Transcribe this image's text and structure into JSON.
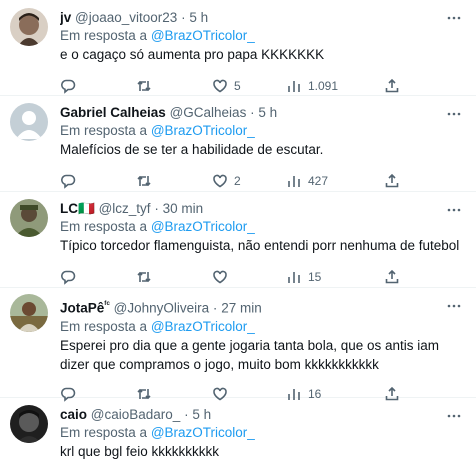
{
  "tweets": [
    {
      "name": "jv",
      "handle": "@joaao_vitoor23",
      "time": "5 h",
      "reply_prefix": "Em resposta a",
      "reply_to": "@BrazOTricolor_",
      "text": "e o cagaço só aumenta pro papa KKKKKKK",
      "likes": "5",
      "views": "1.091",
      "avatar_color": "#8a6d5a"
    },
    {
      "name": "Gabriel Calheias",
      "handle": "@GCalheias",
      "time": "5 h",
      "reply_prefix": "Em resposta a",
      "reply_to": "@BrazOTricolor_",
      "text": "Malefícios de se ter a habilidade de escutar.",
      "likes": "2",
      "views": "427",
      "avatar_color": "#c4cfd6"
    },
    {
      "name": "LC",
      "flag": "🇮🇹",
      "handle": "@lcz_tyf",
      "time": "30 min",
      "reply_prefix": "Em resposta a",
      "reply_to": "@BrazOTricolor_",
      "text": "Típico torcedor flamenguista, não entendi porr nenhuma de futebol",
      "likes": "",
      "views": "15",
      "avatar_color": "#5a6a3e"
    },
    {
      "name": "JotaPê",
      "name_sup": "ᶠᶜ",
      "handle": "@JohnyOliveira",
      "time": "27 min",
      "reply_prefix": "Em resposta a",
      "reply_to": "@BrazOTricolor_",
      "text": "Esperei pro dia que a gente jogaria tanta bola, que os antis iam dizer que compramos o jogo, muito bom kkkkkkkkkkk",
      "likes": "",
      "views": "16",
      "avatar_color": "#7d6a48"
    },
    {
      "name": "caio",
      "handle": "@caioBadaro_",
      "time": "5 h",
      "reply_prefix": "Em resposta a",
      "reply_to": "@BrazOTricolor_",
      "text": "krl que bgl feio kkkkkkkkkk",
      "avatar_color": "#3a3a3a"
    }
  ],
  "separator": "·",
  "icons": {
    "reply": "reply-icon",
    "retweet": "retweet-icon",
    "like": "heart-icon",
    "views": "views-icon",
    "share": "share-icon",
    "more": "more-icon"
  },
  "colors": {
    "accent": "#1d9bf0",
    "muted": "#536471",
    "text": "#0f1419"
  }
}
